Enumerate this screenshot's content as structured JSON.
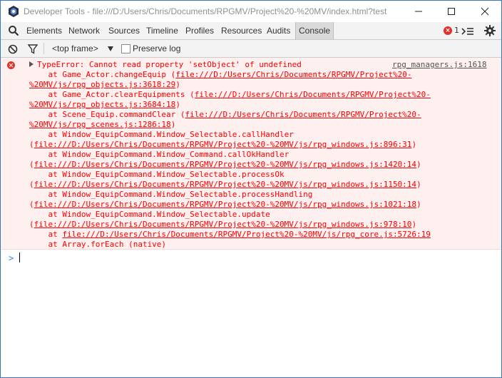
{
  "window": {
    "title": "Developer Tools - file:///D:/Users/Chris/Documents/RPGMV/Project%20-%20MV/index.html?test"
  },
  "tabs": [
    {
      "label": "Elements"
    },
    {
      "label": "Network"
    },
    {
      "label": "Sources"
    },
    {
      "label": "Timeline"
    },
    {
      "label": "Profiles"
    },
    {
      "label": "Resources"
    },
    {
      "label": "Audits"
    },
    {
      "label": "Console",
      "selected": true
    }
  ],
  "error_counter": "1",
  "filterbar": {
    "frame": "<top frame>",
    "preserve_log_label": "Preserve log",
    "preserve_log_checked": false
  },
  "console": {
    "error": {
      "message": "TypeError: Cannot read property 'setObject' of undefined",
      "source": "rpg_managers.js:1618",
      "stack": [
        {
          "pre": "    at Game_Actor.changeEquip (",
          "link": "file:///D:/Users/Chris/Documents/RPGMV/Project%20-",
          "post": ""
        },
        {
          "pre": "",
          "link": "%20MV/js/rpg_objects.js:3618:29",
          "post": ")"
        },
        {
          "pre": "    at Game_Actor.clearEquipments (",
          "link": "file:///D:/Users/Chris/Documents/RPGMV/Project%20-",
          "post": ""
        },
        {
          "pre": "",
          "link": "%20MV/js/rpg_objects.js:3684:18",
          "post": ")"
        },
        {
          "pre": "    at Scene_Equip.commandClear (",
          "link": "file:///D:/Users/Chris/Documents/RPGMV/Project%20-",
          "post": ""
        },
        {
          "pre": "",
          "link": "%20MV/js/rpg_scenes.js:1286:18",
          "post": ")"
        },
        {
          "pre": "    at Window_EquipCommand.Window_Selectable.callHandler",
          "link": "",
          "post": ""
        },
        {
          "pre": "(",
          "link": "file:///D:/Users/Chris/Documents/RPGMV/Project%20-%20MV/js/rpg_windows.js:896:31",
          "post": ")"
        },
        {
          "pre": "    at Window_EquipCommand.Window_Command.callOkHandler",
          "link": "",
          "post": ""
        },
        {
          "pre": "(",
          "link": "file:///D:/Users/Chris/Documents/RPGMV/Project%20-%20MV/js/rpg_windows.js:1420:14",
          "post": ")"
        },
        {
          "pre": "    at Window_EquipCommand.Window_Selectable.processOk",
          "link": "",
          "post": ""
        },
        {
          "pre": "(",
          "link": "file:///D:/Users/Chris/Documents/RPGMV/Project%20-%20MV/js/rpg_windows.js:1150:14",
          "post": ")"
        },
        {
          "pre": "    at Window_EquipCommand.Window_Selectable.processHandling",
          "link": "",
          "post": ""
        },
        {
          "pre": "(",
          "link": "file:///D:/Users/Chris/Documents/RPGMV/Project%20-%20MV/js/rpg_windows.js:1021:18",
          "post": ")"
        },
        {
          "pre": "    at Window_EquipCommand.Window_Selectable.update",
          "link": "",
          "post": ""
        },
        {
          "pre": "(",
          "link": "file:///D:/Users/Chris/Documents/RPGMV/Project%20-%20MV/js/rpg_windows.js:978:10",
          "post": ")"
        },
        {
          "pre": "    at ",
          "link": "file:///D:/Users/Chris/Documents/RPGMV/Project%20-%20MV/js/rpg_core.js:5726:19",
          "post": ""
        },
        {
          "pre": "    at Array.forEach (native)",
          "link": "",
          "post": ""
        }
      ]
    },
    "prompt_symbol": ">"
  },
  "colors": {
    "error_text": "#ff0000",
    "error_bg": "#fff0f0",
    "prompt": "#367cf1",
    "window_border": "#3c74c4"
  }
}
